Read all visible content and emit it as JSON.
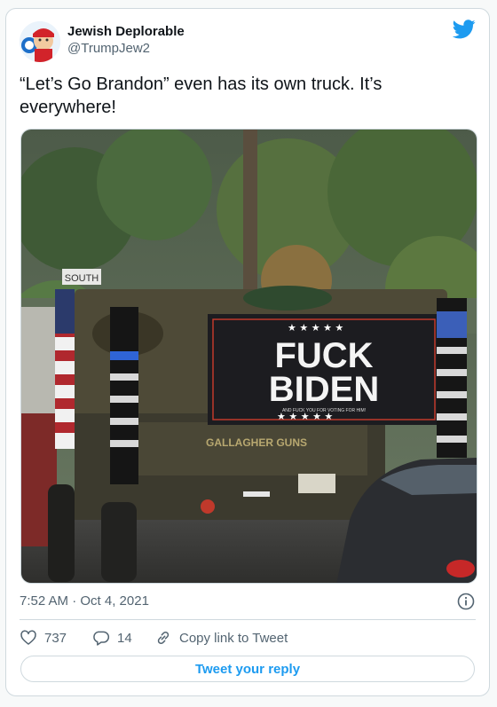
{
  "author": {
    "display_name": "Jewish Deplorable",
    "handle": "@TrumpJew2"
  },
  "tweet": {
    "text": "“Let’s Go Brandon” even has its own truck. It’s everywhere!",
    "timestamp": "7:52 AM · Oct 4, 2021"
  },
  "media": {
    "sign_street": "SOUTH",
    "banner_line1": "FUCK",
    "banner_line2": "BIDEN",
    "banner_subtext": "AND FUCK YOU FOR VOTING FOR HIM!",
    "tailgate_text": "GALLAGHER GUNS"
  },
  "actions": {
    "likes": "737",
    "replies": "14",
    "copy_link_label": "Copy link to Tweet"
  },
  "reply_button_label": "Tweet your reply",
  "icons": {
    "brand": "twitter-bird-icon",
    "like": "heart-icon",
    "reply": "reply-bubble-icon",
    "link": "link-icon",
    "info": "info-icon"
  },
  "colors": {
    "accent": "#1d9bf0",
    "secondary_text": "#536471",
    "border": "#cfd9de"
  }
}
